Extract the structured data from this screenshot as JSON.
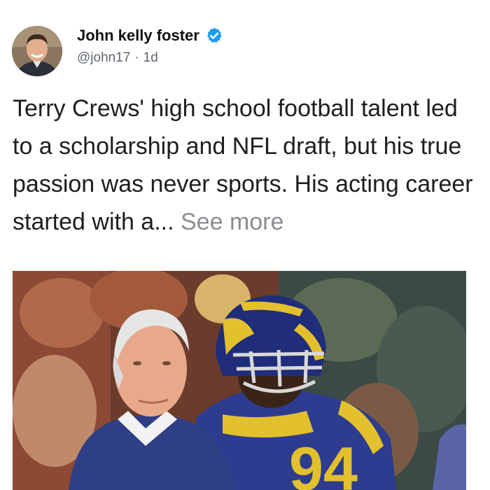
{
  "post": {
    "author_name": "John kelly foster",
    "handle": "@john17",
    "separator": "·",
    "timestamp": "1d",
    "text": "Terry Crews' high school football talent led to a scholarship and NFL draft, but his true passion was never sports. His acting career started with a...",
    "see_more_label": "See more",
    "verified_icon": "verified-check-icon",
    "accent_color": "#1d9bf0",
    "jersey_number": "94"
  }
}
